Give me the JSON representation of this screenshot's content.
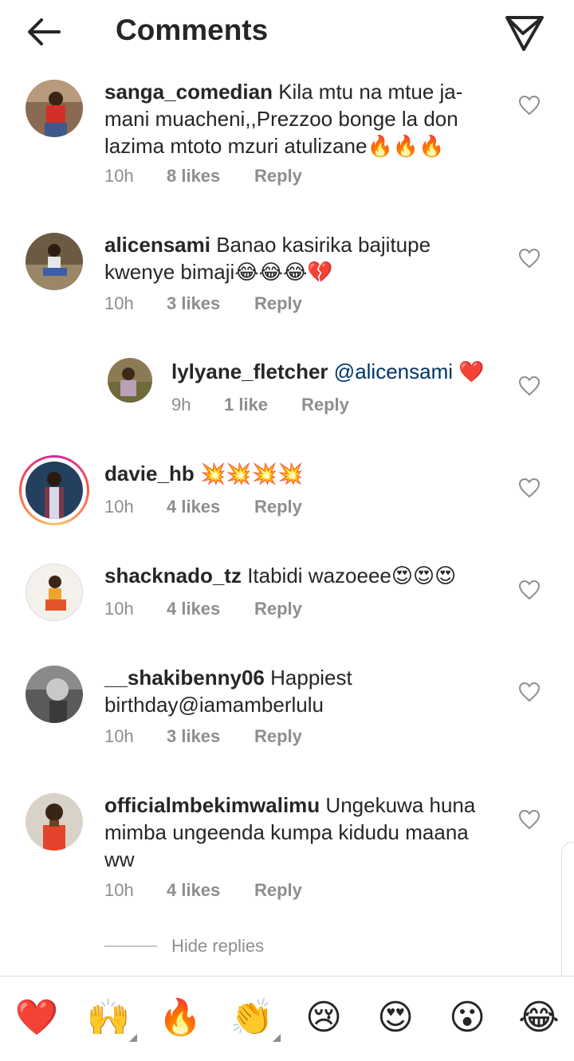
{
  "header": {
    "title": "Comments",
    "back_icon": "arrow-left-icon",
    "send_icon": "paper-plane-icon"
  },
  "comments": [
    {
      "username": "sanga_comedian",
      "text": "Kila mtu na mtue ja-mani muacheni,,Prezzoo bonge la don lazima mtoto mzuri atulizane🔥🔥🔥",
      "time": "10h",
      "likes": "8 likes",
      "reply": "Reply"
    },
    {
      "username": "alicensami",
      "text": "Banao kasirika bajitupe kwenye bimaji😂😂😂💔",
      "time": "10h",
      "likes": "3 likes",
      "reply": "Reply"
    },
    {
      "username": "lylyane_fletcher",
      "mention": "@alicensami",
      "text": "❤️",
      "time": "9h",
      "likes": "1 like",
      "reply": "Reply"
    },
    {
      "username": "davie_hb",
      "text": "💥💥💥💥",
      "time": "10h",
      "likes": "4 likes",
      "reply": "Reply"
    },
    {
      "username": "shacknado_tz",
      "text": "Itabidi wazoeee😍😍😍",
      "time": "10h",
      "likes": "4 likes",
      "reply": "Reply"
    },
    {
      "username": "__shakibenny06",
      "text": "Happiest birthday@iamamberlulu",
      "time": "10h",
      "likes": "3 likes",
      "reply": "Reply"
    },
    {
      "username": "officialmbekimwalimu",
      "text": "Ungekuwa huna mimba ungeenda kumpa kidudu maana ww",
      "time": "10h",
      "likes": "4 likes",
      "reply": "Reply"
    }
  ],
  "hide_replies": "Hide replies",
  "emoji_bar": [
    "❤️",
    "🙌",
    "🔥",
    "👏",
    "😢",
    "😍",
    "😮",
    "😂"
  ],
  "colors": {
    "text": "#262626",
    "secondary": "#8e8e8e",
    "mention": "#003569",
    "divider": "#dbdbdb",
    "story_ring": "#d6249f"
  }
}
